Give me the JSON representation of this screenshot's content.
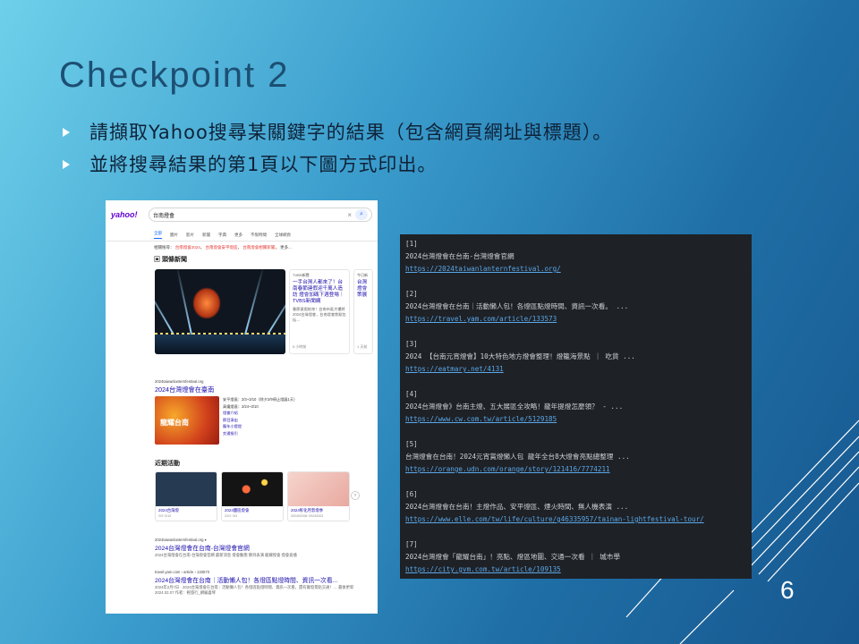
{
  "slide": {
    "title": "Checkpoint 2",
    "bullets": [
      "請擷取Yahoo搜尋某關鍵字的結果（包含網頁網址與標題）。",
      "並將搜尋結果的第1頁以下圖方式印出。"
    ],
    "page_number": "6"
  },
  "yahoo": {
    "logo": "yahoo!",
    "query": "台南燈會",
    "clear_icon": "×",
    "search_icon": "🔍",
    "tabs": [
      "全部",
      "圖片",
      "影片",
      "新聞",
      "字典",
      "更多",
      "不限時間",
      "全球網頁"
    ],
    "related": {
      "label": "相關搜尋：",
      "items": [
        "台南燈會2024",
        "台南燈會安平燈區",
        "台南燈會相關新聞",
        "更多..."
      ]
    },
    "news_heading": "頭條新聞",
    "news_card": {
      "source": "TVBS新聞",
      "headline": "一手台灣人都來了！台南春節連假迎千萬人造訪 燈會加碼下週登場｜TVBS新聞網",
      "snippet": "春節連假結束！台南市區大樓將2024台灣燈會，台南燈會焦點包括…",
      "time": "5 小時前"
    },
    "news_card2": {
      "source": "今日新",
      "headline": "台灣燈會策展",
      "time": "1 天前"
    },
    "site": {
      "url": "2024taiwanlanternfestival.org",
      "title": "2024台灣燈會在臺南",
      "poster": "龍耀台南",
      "links": [
        "安平燈區：2/3~3/10（除夕2/9停止燈展1天）",
        "高鐵燈區：2/24~3/10",
        "燈會介紹",
        "節目演出",
        "龍年小提燈",
        "交通指引"
      ]
    },
    "events_heading": "近期活動",
    "events": [
      {
        "name": "2024台灣燈",
        "date": "2/3~3/10",
        "color": "#263a52"
      },
      {
        "name": "2024鹽區燈會",
        "date": "2/21~3/3",
        "color": "#141414"
      },
      {
        "name": "2024彰化月影燈季",
        "date": "2024/02/08~2024/03/3",
        "color": "#f0c8c0"
      }
    ],
    "next": "›",
    "results": [
      {
        "url": "2024taiwanlanternfestival.org ▾",
        "title": "2024台灣燈會在台南-台灣燈會官網",
        "desc": "2024台灣燈會在台南-台灣燈會官網 最新消息 燈會動態 節目表演 龍耀燈會 燈會直播"
      },
      {
        "url": "travel.yam.com › article › 133573",
        "title": "2024台灣燈會在台南｜活動懶人包！各燈區點燈時間、資訊一次看...",
        "desc": "2024年2月7日 · 2024台灣燈會在台南｜活動懶人包！各燈區點燈時間、資訊一次看，還有賞燈景點交通！… 最後更新 2024.02.07 作者：輕旅行_網編喜琴"
      }
    ]
  },
  "terminal": {
    "entries": [
      {
        "index": "[1]",
        "title": "2024台灣燈會在台南-台灣燈會官網",
        "url": "https://2024taiwanlanternfestival.org/"
      },
      {
        "index": "[2]",
        "title": "2024台灣燈會在台南｜活動懶人包！各燈區點燈時間、資訊一次看。 ...",
        "url": "https://travel.yam.com/article/133573"
      },
      {
        "index": "[3]",
        "title": "2024 【台南元宵燈會】10大特色地方燈會整理！燈籠海景點 ｜ 吃貨 ...",
        "url": "https://eatmary.net/4131"
      },
      {
        "index": "[4]",
        "title": "2024台灣燈會》台南主燈、五大展區全攻略！龍年提燈怎麼領？ - ...",
        "url": "https://www.cw.com.tw/article/5129185"
      },
      {
        "index": "[5]",
        "title": "台灣燈會在台南！2024元宵賞燈懶人包 龍年全台8大燈會亮點總整理 ...",
        "url": "https://orange.udn.com/orange/story/121416/7774211"
      },
      {
        "index": "[6]",
        "title": "2024台灣燈會在台南！主燈作品、安平燈區、煙火時間、無人機表演 ...",
        "url": "https://www.elle.com/tw/life/culture/g46335957/tainan-lightfestival-tour/"
      },
      {
        "index": "[7]",
        "title": "2024台灣燈會「龍耀台南」！亮點、燈區地圖、交通一次看 ｜ 城市學",
        "url": "https://city.gvm.com.tw/article/109135"
      }
    ]
  }
}
